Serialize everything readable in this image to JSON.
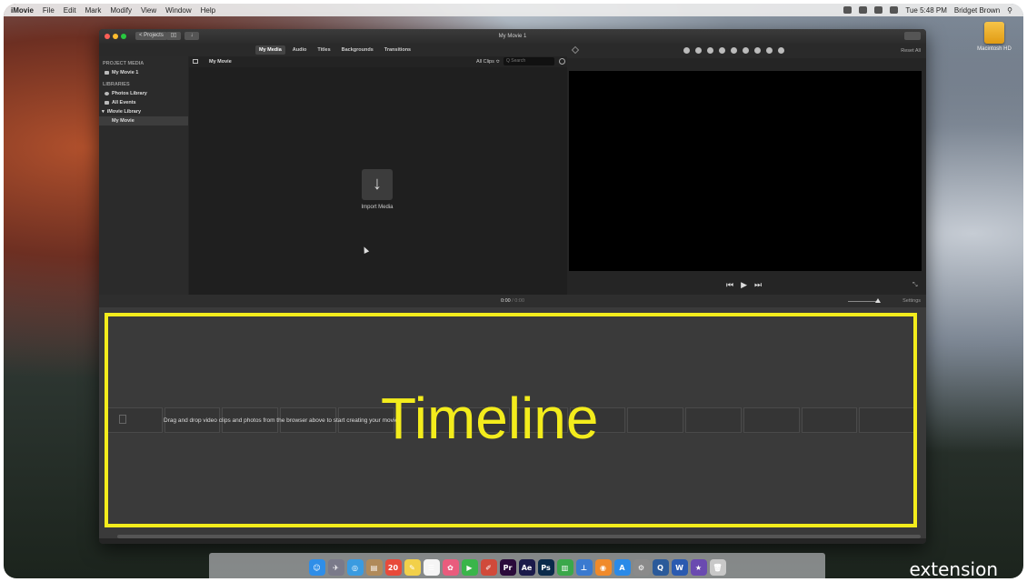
{
  "menubar": {
    "app": "iMovie",
    "items": [
      "File",
      "Edit",
      "Mark",
      "Modify",
      "View",
      "Window",
      "Help"
    ],
    "clock": "Tue 5:48 PM",
    "user": "Bridget Brown"
  },
  "desktop": {
    "drive_label": "Macintosh HD"
  },
  "window": {
    "title": "My Movie 1",
    "projects_button": "< Projects"
  },
  "tabs": [
    "My Media",
    "Audio",
    "Titles",
    "Backgrounds",
    "Transitions"
  ],
  "active_tab": "My Media",
  "sidebar": {
    "project_media_heading": "PROJECT MEDIA",
    "project_item": "My Movie 1",
    "libraries_heading": "LIBRARIES",
    "photos_library": "Photos Library",
    "all_events": "All Events",
    "library_group": "iMovie Library",
    "event_selected": "My Movie"
  },
  "browser": {
    "title": "My Movie",
    "clips_filter": "All Clips ≎",
    "search_placeholder": "Q Search",
    "import_icon": "↓",
    "import_label": "Import Media"
  },
  "viewer": {
    "reset_all": "Reset All",
    "transport": {
      "prev": "⏮",
      "play": "▶",
      "next": "⏭"
    },
    "fullscreen": "⤡"
  },
  "timeline": {
    "timecode_current": "0:00",
    "timecode_sep": " / ",
    "timecode_total": "0:00",
    "settings_label": "Settings",
    "hint": "Drag and drop video clips and photos from the browser above to start creating your movie.",
    "overlay_label": "Timeline"
  },
  "dock": {
    "icons": [
      {
        "name": "finder-icon",
        "glyph": "☺",
        "color": "#2f8ee8"
      },
      {
        "name": "launchpad-icon",
        "glyph": "✈",
        "color": "#7a7a8a"
      },
      {
        "name": "safari-icon",
        "glyph": "◎",
        "color": "#3a9be0"
      },
      {
        "name": "contacts-icon",
        "glyph": "▤",
        "color": "#b08a5a"
      },
      {
        "name": "calendar-icon",
        "glyph": "20",
        "color": "#e84a3a"
      },
      {
        "name": "notes-icon",
        "glyph": "✎",
        "color": "#f2d04a"
      },
      {
        "name": "reminders-icon",
        "glyph": "☰",
        "color": "#f5f5f5"
      },
      {
        "name": "photos-icon",
        "glyph": "✿",
        "color": "#e95c7d"
      },
      {
        "name": "facetime-icon",
        "glyph": "▶",
        "color": "#3ab54a"
      },
      {
        "name": "imovie-notes-icon",
        "glyph": "✐",
        "color": "#d04a3a"
      },
      {
        "name": "premiere-icon",
        "glyph": "Pr",
        "color": "#2a0a3a"
      },
      {
        "name": "aftereffects-icon",
        "glyph": "Ae",
        "color": "#1a1a4a"
      },
      {
        "name": "photoshop-icon",
        "glyph": "Ps",
        "color": "#0a2a4a"
      },
      {
        "name": "numbers-icon",
        "glyph": "▥",
        "color": "#3aa84a"
      },
      {
        "name": "keynote-icon",
        "glyph": "⊥",
        "color": "#3a7ad0"
      },
      {
        "name": "ibooks-icon",
        "glyph": "◉",
        "color": "#f08a2a"
      },
      {
        "name": "appstore-icon",
        "glyph": "A",
        "color": "#2a8ae8"
      },
      {
        "name": "system-preferences-icon",
        "glyph": "⚙",
        "color": "#8a8a8a"
      },
      {
        "name": "quicktime-icon",
        "glyph": "Q",
        "color": "#2a5a9a"
      },
      {
        "name": "word-icon",
        "glyph": "W",
        "color": "#2a5ab0"
      },
      {
        "name": "imovie-icon",
        "glyph": "★",
        "color": "#6a4ab0"
      },
      {
        "name": "trash-icon",
        "glyph": "🗑",
        "color": "#c8c8c8"
      }
    ]
  },
  "watermark": "extension",
  "colors": {
    "highlight": "#f3ec1c",
    "viewer_bg": "#000000"
  }
}
